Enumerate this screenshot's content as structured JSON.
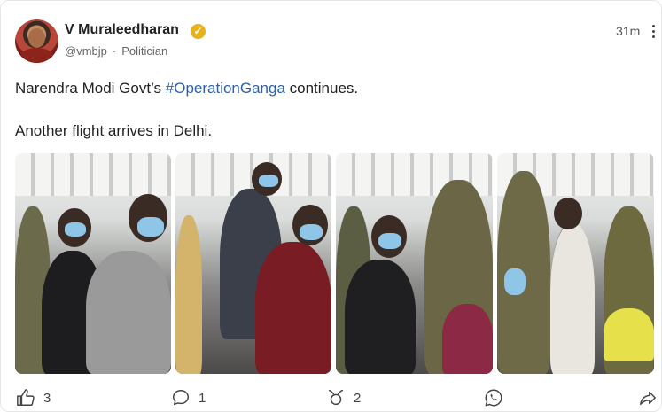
{
  "post": {
    "author_name": "V Muraleedharan",
    "verified_icon": "verified-badge-icon",
    "handle": "@vmbjp",
    "separator": "·",
    "role": "Politician",
    "time": "31m",
    "text_prefix": "Narendra Modi Govt’s ",
    "hashtag": "#OperationGanga",
    "text_suffix": " continues.",
    "text_line2": "Another flight arrives in Delhi.",
    "colors": {
      "hashtag": "#2b5fa6",
      "verified": "#e8b21a"
    }
  },
  "actions": {
    "like_count": "3",
    "comment_count": "1",
    "repost_count": "2"
  }
}
